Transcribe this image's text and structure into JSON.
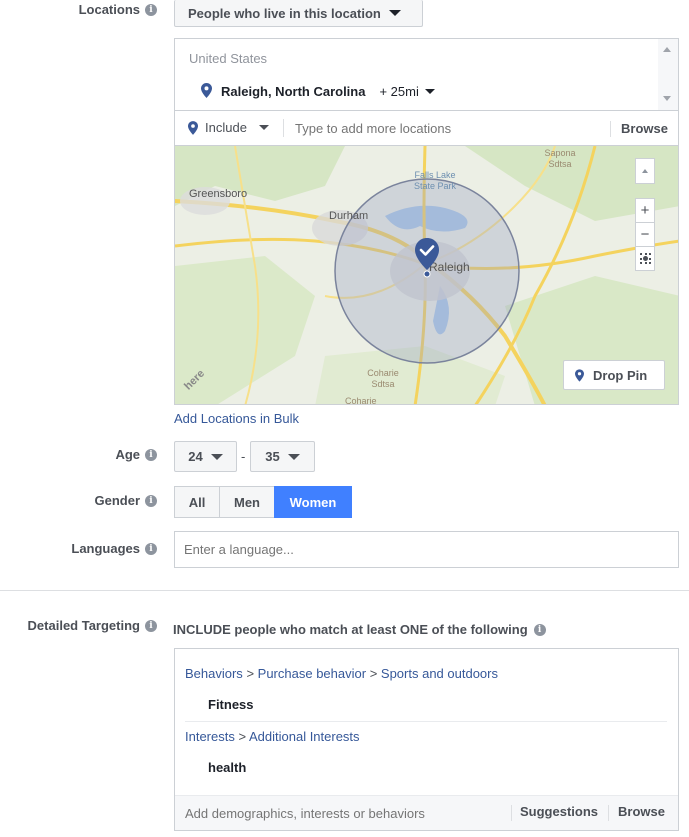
{
  "locations": {
    "label": "Locations",
    "type_dropdown": "People who live in this location",
    "country": "United States",
    "selected_location": "Raleigh, North Carolina",
    "radius": "+ 25mi",
    "include_label": "Include",
    "input_placeholder": "Type to add more locations",
    "browse": "Browse",
    "map": {
      "places": [
        "Greensboro",
        "Durham",
        "Falls Lake State Park",
        "Raleigh",
        "Sapona Sdtsa",
        "Coharie Sdtsa",
        "Coharie"
      ],
      "watermark": "here",
      "drop_pin": "Drop Pin",
      "zoom_in": "+",
      "zoom_out": "−"
    },
    "bulk_link": "Add Locations in Bulk"
  },
  "age": {
    "label": "Age",
    "min": "24",
    "separator": "-",
    "max": "35"
  },
  "gender": {
    "label": "Gender",
    "options": [
      "All",
      "Men",
      "Women"
    ],
    "selected": "Women"
  },
  "languages": {
    "label": "Languages",
    "placeholder": "Enter a language..."
  },
  "detailed_targeting": {
    "label": "Detailed Targeting",
    "include_text": "INCLUDE people who match at least ONE of the following",
    "groups": [
      {
        "path": [
          "Behaviors",
          "Purchase behavior",
          "Sports and outdoors"
        ],
        "item": "Fitness"
      },
      {
        "path": [
          "Interests",
          "Additional Interests"
        ],
        "item": "health"
      }
    ],
    "path_separator": ">",
    "input_placeholder": "Add demographics, interests or behaviors",
    "suggestions": "Suggestions",
    "browse": "Browse"
  },
  "colors": {
    "accent": "#4080ff",
    "link": "#365899",
    "pin": "#3b5998"
  }
}
